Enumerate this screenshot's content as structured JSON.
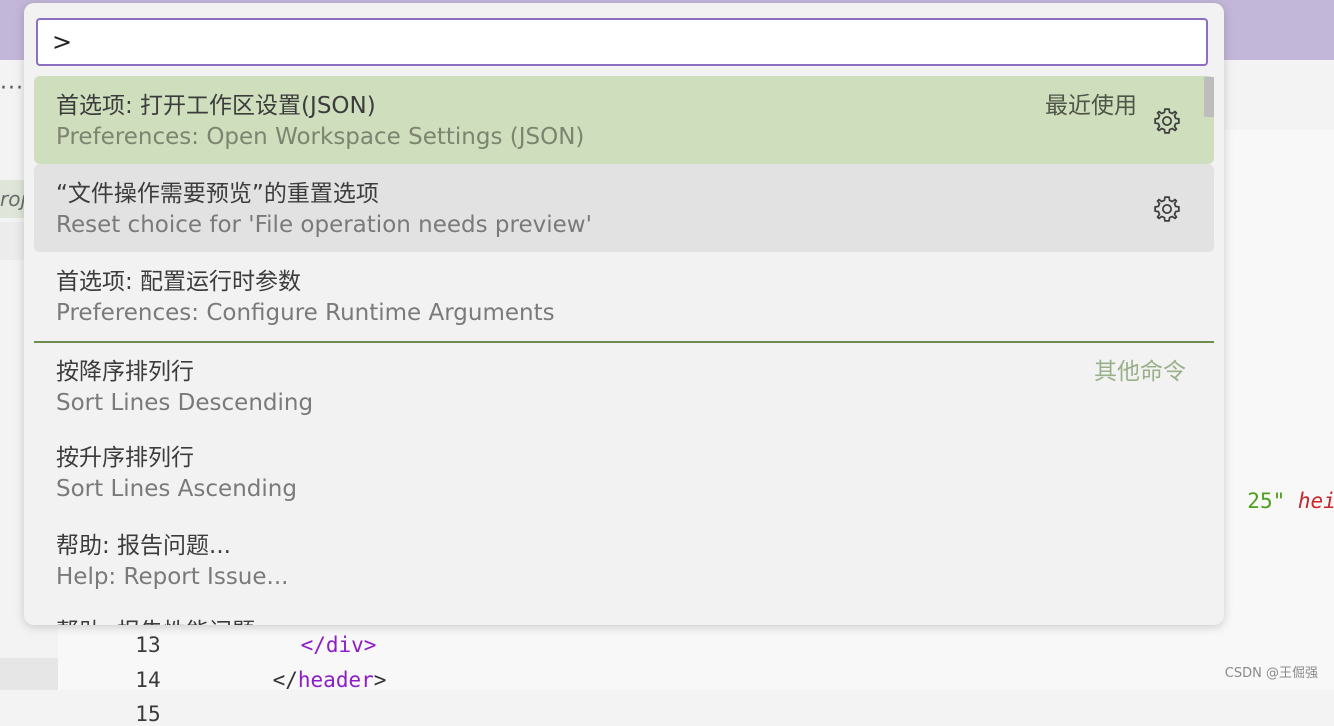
{
  "palette": {
    "input_value": ">"
  },
  "commands": [
    {
      "label": "首选项: 打开工作区设置(JSON)",
      "detail": "Preferences: Open Workspace Settings (JSON)",
      "group": "最近使用",
      "has_gear": true,
      "state": "focused"
    },
    {
      "label": "“文件操作需要预览”的重置选项",
      "detail": "Reset choice for 'File operation needs preview'",
      "group": "",
      "has_gear": true,
      "state": "hovered"
    },
    {
      "label": "首选项: 配置运行时参数",
      "detail": "Preferences: Configure Runtime Arguments",
      "group": "",
      "has_gear": false,
      "state": "normal"
    },
    {
      "label": "按降序排列行",
      "detail": "Sort Lines Descending",
      "group": "其他命令",
      "has_gear": false,
      "state": "normal"
    },
    {
      "label": "按升序排列行",
      "detail": "Sort Lines Ascending",
      "group": "",
      "has_gear": false,
      "state": "normal"
    },
    {
      "label": "帮助: 报告问题...",
      "detail": "Help: Report Issue...",
      "group": "",
      "has_gear": false,
      "state": "normal"
    },
    {
      "label": "帮助: 报告性能问题",
      "detail": "",
      "group": "",
      "has_gear": false,
      "state": "normal"
    }
  ],
  "editor": {
    "more_actions": "···",
    "tab_fragment": "roj",
    "line_13_number": "13",
    "line_13_text": "</div>",
    "line_14_number": "14",
    "line_14_open": "</",
    "line_14_tag": "header",
    "line_14_close": ">",
    "line_15_number": "15",
    "right_string": "25\"",
    "right_attr": "heig"
  },
  "watermark": "CSDN @王倔强",
  "icons": {
    "gear": "gear-icon"
  }
}
